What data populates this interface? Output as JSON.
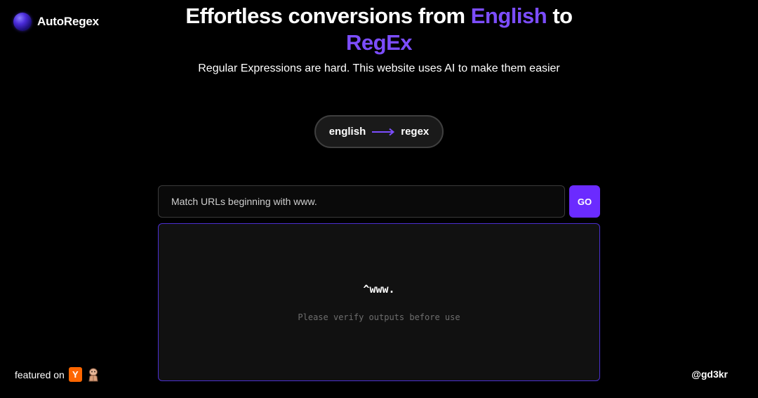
{
  "brand": {
    "name": "AutoRegex"
  },
  "hero": {
    "title_pre": "Effortless conversions from ",
    "title_accent1": "English",
    "title_mid": " to",
    "title_accent2": "RegEx",
    "subtitle": "Regular Expressions are hard. This website uses AI to make them easier"
  },
  "mode": {
    "from": "english",
    "to": "regex"
  },
  "query": {
    "placeholder": "Match URLs beginning with www.",
    "value": ""
  },
  "go_label": "GO",
  "output": {
    "regex": "^www.",
    "note": "Please verify outputs before use"
  },
  "footer": {
    "featured_label": "featured on",
    "yc_letter": "Y",
    "handle": "@gd3kr"
  },
  "colors": {
    "accent": "#7c4dff",
    "button": "#6b2bff",
    "border": "#4b2fd0",
    "yc": "#ff6600"
  },
  "icons": [
    "logo-orb-icon",
    "arrow-right-icon",
    "ycombinator-icon",
    "product-hunt-icon"
  ]
}
